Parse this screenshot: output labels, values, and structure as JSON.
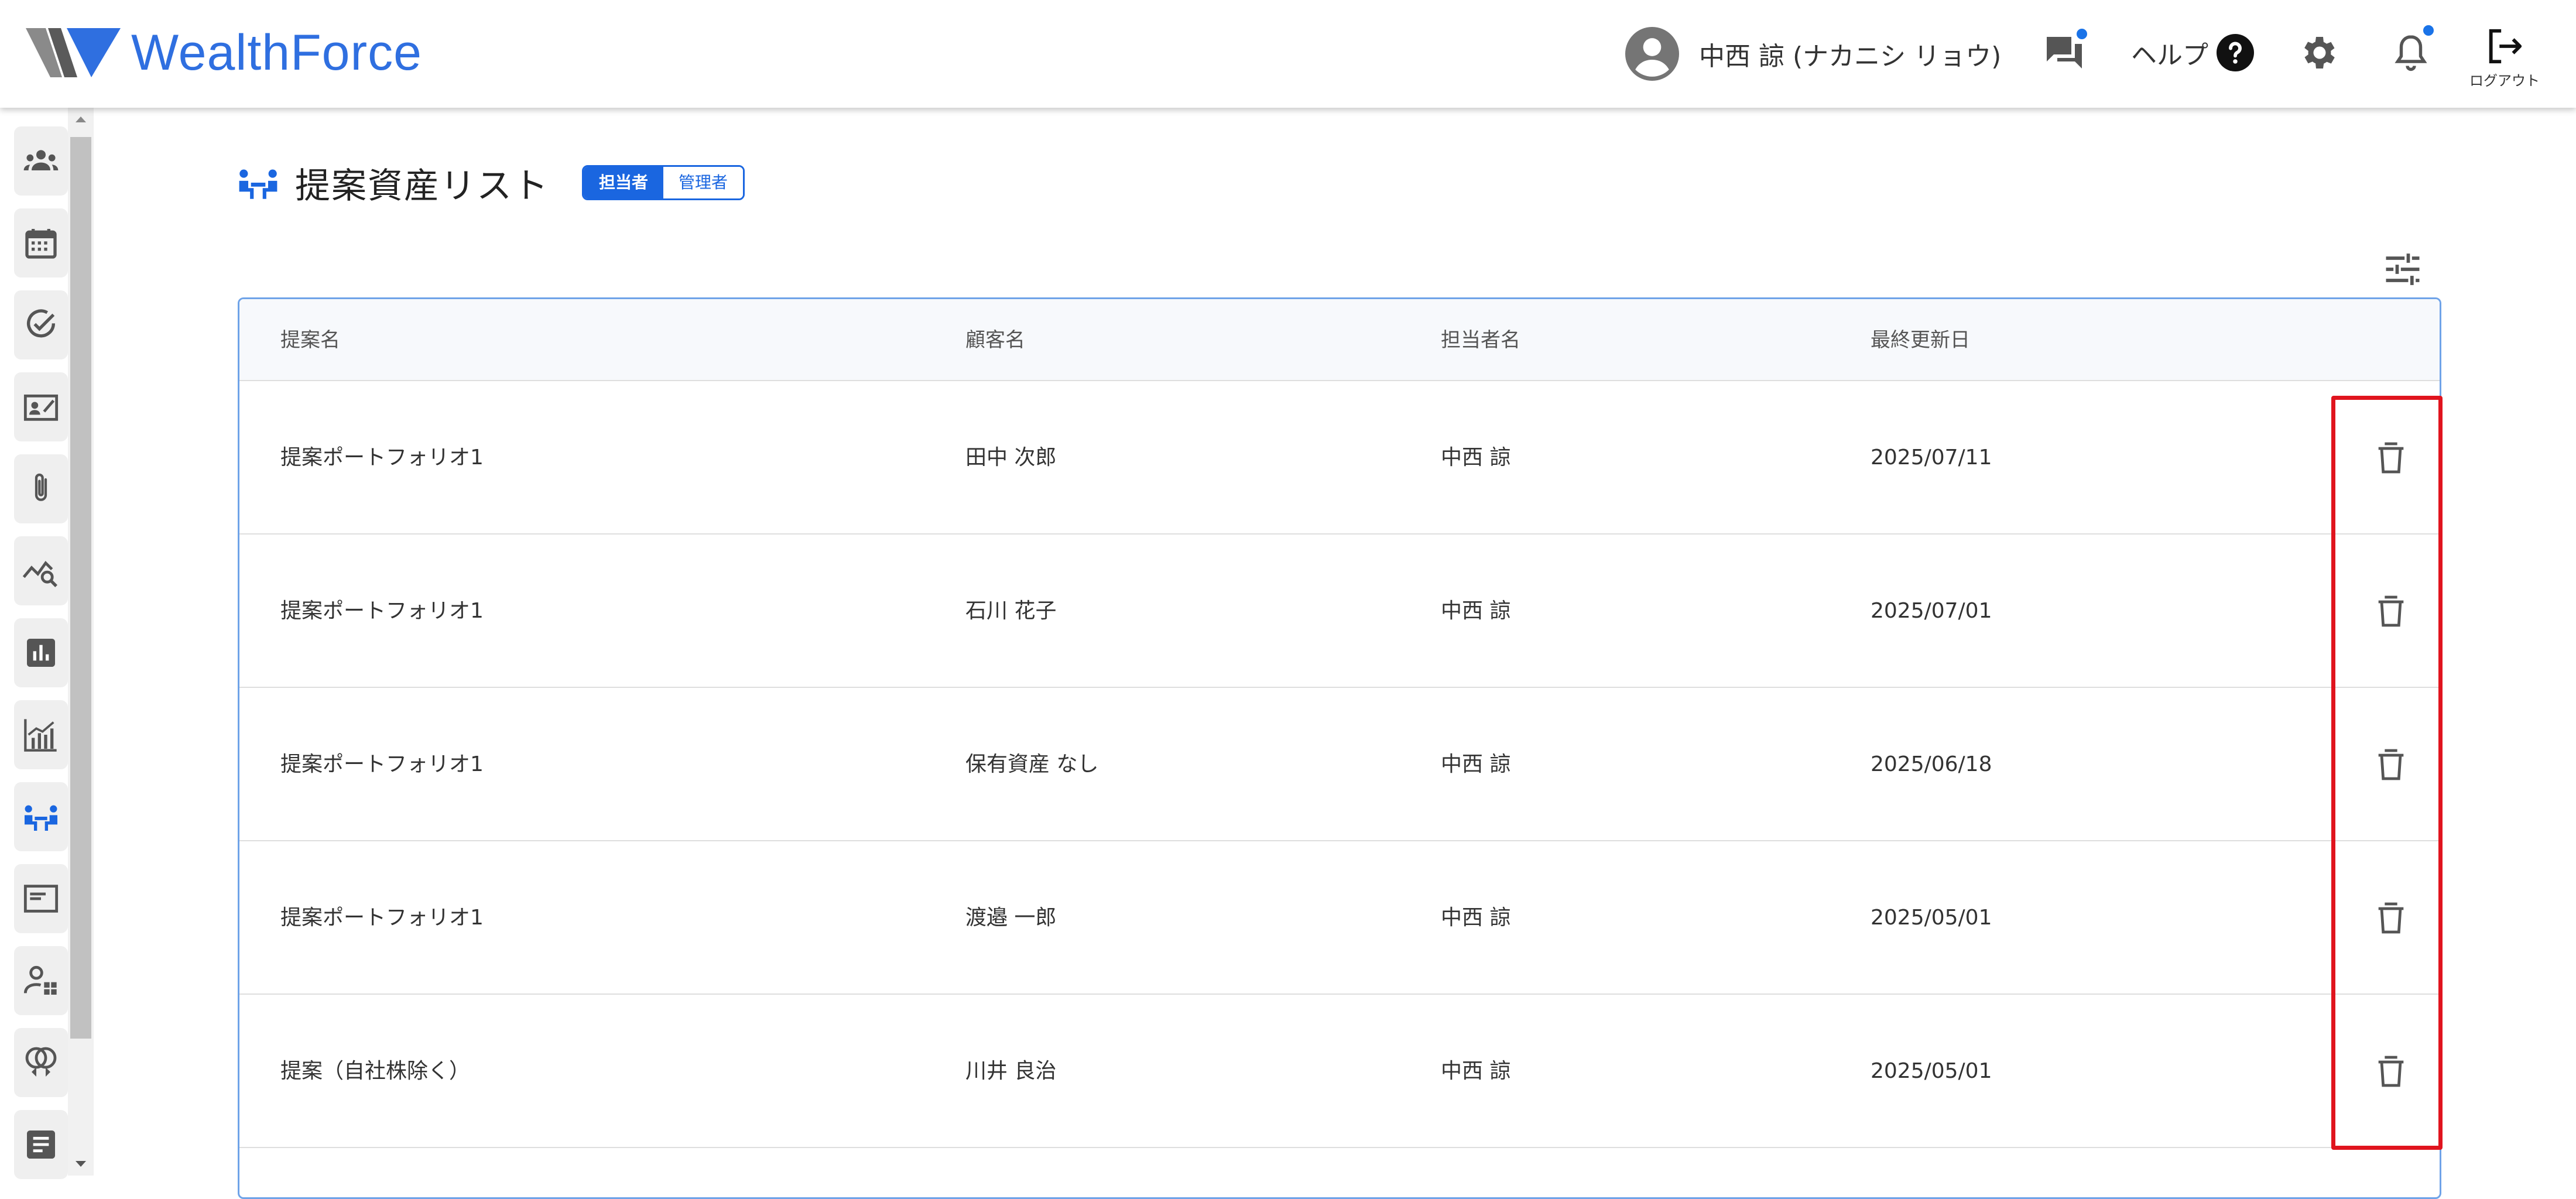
{
  "header": {
    "logo_text": "WealthForce",
    "user_name": "中西 諒 (ナカニシ リョウ)",
    "help_label": "ヘルプ",
    "logout_label": "ログアウト",
    "icons": [
      "user-avatar-icon",
      "chat-icon",
      "help-icon",
      "gear-icon",
      "bell-icon",
      "logout-icon"
    ]
  },
  "sidebar": {
    "items": [
      {
        "icon": "people-group-icon"
      },
      {
        "icon": "calendar-icon"
      },
      {
        "icon": "check-circle-icon"
      },
      {
        "icon": "contact-card-icon"
      },
      {
        "icon": "paperclip-icon"
      },
      {
        "icon": "chart-search-icon"
      },
      {
        "icon": "bar-chart-icon"
      },
      {
        "icon": "line-bar-chart-icon"
      },
      {
        "icon": "proposal-meeting-icon",
        "active": true
      },
      {
        "icon": "document-window-icon"
      },
      {
        "icon": "user-dashboard-icon"
      },
      {
        "icon": "rings-icon"
      },
      {
        "icon": "note-icon"
      }
    ]
  },
  "page": {
    "title": "提案資産リスト",
    "role_tabs": {
      "owner": "担当者",
      "admin": "管理者"
    }
  },
  "table": {
    "headers": [
      "提案名",
      "顧客名",
      "担当者名",
      "最終更新日"
    ],
    "rows": [
      [
        "提案ポートフォリオ1",
        "田中 次郎",
        "中西 諒",
        "2025/07/11"
      ],
      [
        "提案ポートフォリオ1",
        "石川 花子",
        "中西 諒",
        "2025/07/01"
      ],
      [
        "提案ポートフォリオ1",
        "保有資産 なし",
        "中西 諒",
        "2025/06/18"
      ],
      [
        "提案ポートフォリオ1",
        "渡邉 一郎",
        "中西 諒",
        "2025/05/01"
      ],
      [
        "提案（自社株除く）",
        "川井 良治",
        "中西 諒",
        "2025/05/01"
      ]
    ]
  },
  "colors": {
    "brand_blue": "#2f6fe0",
    "accent_blue": "#1a66e0",
    "highlight_red": "#e0141e",
    "table_border": "#6fa3e8"
  }
}
